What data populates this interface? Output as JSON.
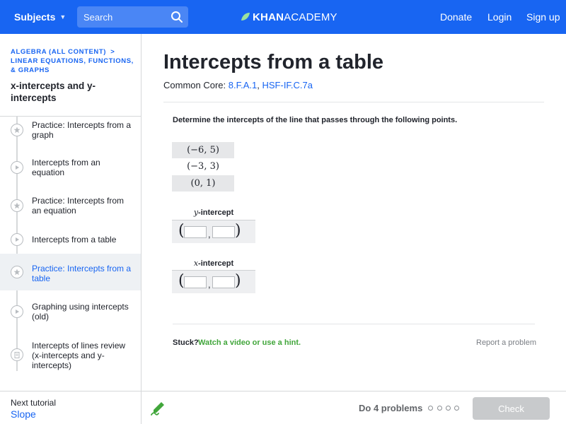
{
  "header": {
    "subjects_label": "Subjects",
    "search_placeholder": "Search",
    "logo_bold": "KHAN",
    "logo_light": "ACADEMY",
    "donate": "Donate",
    "login": "Login",
    "signup": "Sign up"
  },
  "sidebar": {
    "breadcrumb_1": "Algebra (all content)",
    "breadcrumb_sep": ">",
    "breadcrumb_2": "Linear equations, functions, & graphs",
    "tutorial_title": "x-intercepts and y-intercepts",
    "items": [
      {
        "label": "Practice: Intercepts from a graph",
        "icon": "star-icon"
      },
      {
        "label": "Intercepts from an equation",
        "icon": "play-icon"
      },
      {
        "label": "Practice: Intercepts from an equation",
        "icon": "star-icon"
      },
      {
        "label": "Intercepts from a table",
        "icon": "play-icon"
      },
      {
        "label": "Practice: Intercepts from a table",
        "icon": "star-icon"
      },
      {
        "label": "Graphing using intercepts (old)",
        "icon": "play-icon"
      },
      {
        "label": "Intercepts of lines review (x-intercepts and y-intercepts)",
        "icon": "article-icon"
      }
    ],
    "next_label": "Next tutorial",
    "next_link": "Slope"
  },
  "main": {
    "title": "Intercepts from a table",
    "common_core_label": "Common Core:",
    "cc_link_1": "8.F.A.1",
    "cc_sep": ",",
    "cc_link_2": "HSF-IF.C.7a",
    "prompt": "Determine the intercepts of the line that passes through the following points.",
    "points": [
      "(−6, 5)",
      "(−3, 3)",
      "(0, 1)"
    ],
    "y_intercept_var": "y",
    "y_intercept_label": "-intercept",
    "x_intercept_var": "x",
    "x_intercept_label": "-intercept",
    "open_paren": "(",
    "close_paren": ")",
    "comma": ",",
    "stuck_label": "Stuck?",
    "stuck_link": "Watch a video or use a hint.",
    "report": "Report a problem"
  },
  "footer": {
    "do_problems": "Do 4 problems",
    "check": "Check"
  },
  "colors": {
    "brand_blue": "#1865f2",
    "hint_green": "#41a63b",
    "check_disabled": "#c8cacc"
  }
}
